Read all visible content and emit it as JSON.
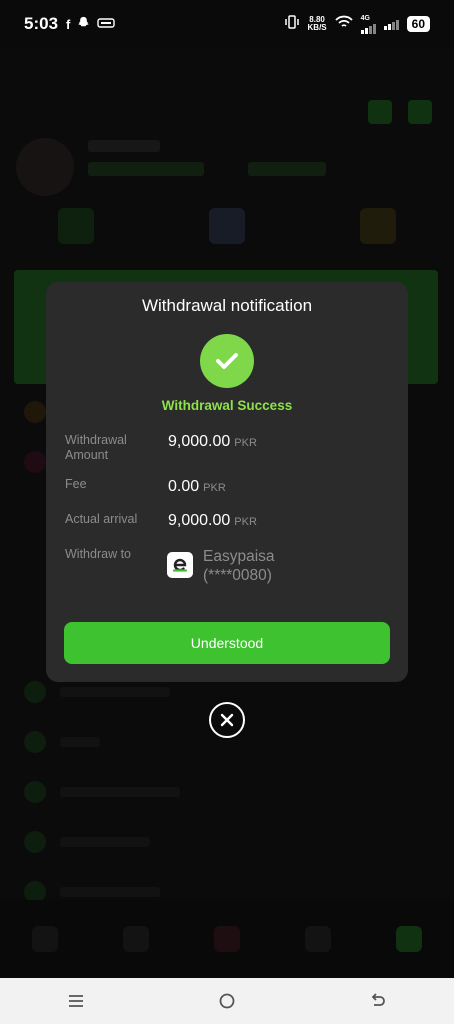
{
  "status_bar": {
    "time": "5:03",
    "net_speed_value": "8.80",
    "net_speed_unit": "KB/S",
    "network_type": "4G",
    "battery": "60",
    "notification_icons": [
      "facebook-icon",
      "snapchat-icon",
      "hd-icon"
    ]
  },
  "modal": {
    "title": "Withdrawal notification",
    "status": "Withdrawal Success",
    "details": {
      "amount_label_line1": "Withdrawal",
      "amount_label_line2": "Amount",
      "amount_value": "9,000.00",
      "amount_currency": "PKR",
      "fee_label": "Fee",
      "fee_value": "0.00",
      "fee_currency": "PKR",
      "arrival_label": "Actual arrival",
      "arrival_value": "9,000.00",
      "arrival_currency": "PKR",
      "withdraw_to_label": "Withdraw to",
      "wallet_name": "Easypaisa",
      "wallet_account": "(****0080)"
    },
    "button_label": "Understood"
  },
  "colors": {
    "accent_green": "#3fc230",
    "success_green": "#8ee04b",
    "modal_bg": "#2b2b2b"
  }
}
